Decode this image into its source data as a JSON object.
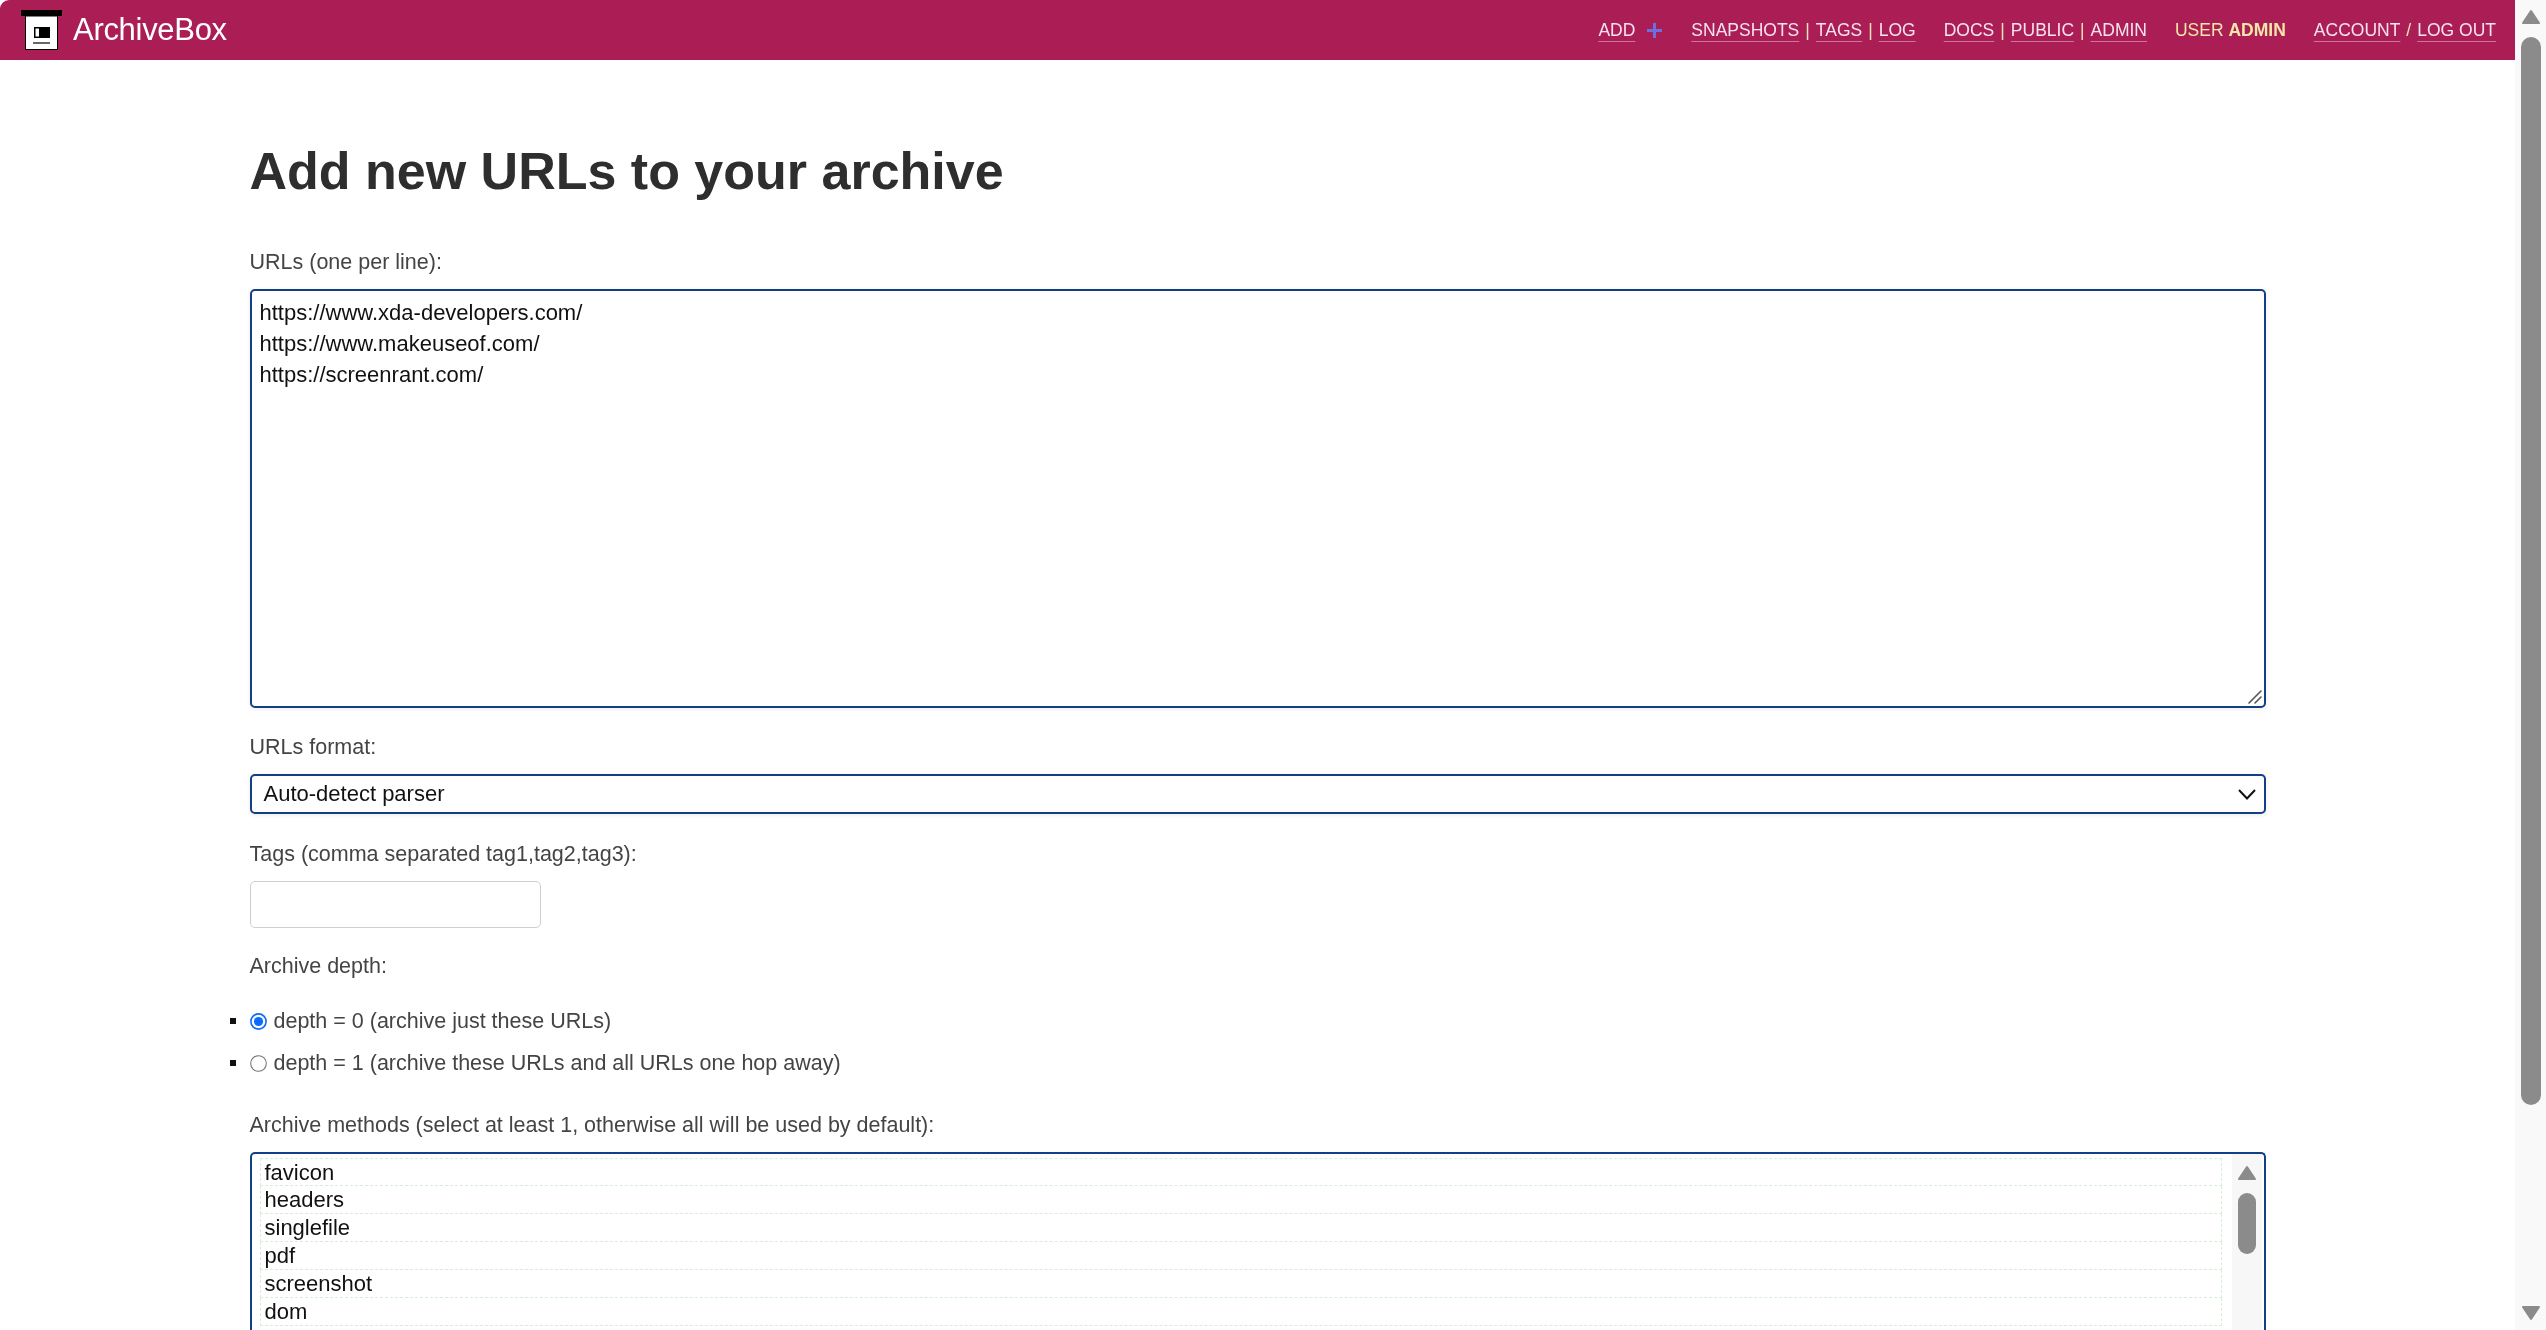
{
  "header": {
    "title": "ArchiveBox",
    "nav": [
      {
        "items": [
          {
            "kind": "add",
            "text": "ADD"
          }
        ]
      },
      {
        "items": [
          {
            "kind": "link",
            "text": "SNAPSHOTS"
          },
          {
            "kind": "sep",
            "text": "|"
          },
          {
            "kind": "link",
            "text": "TAGS"
          },
          {
            "kind": "sep",
            "text": "|"
          },
          {
            "kind": "link",
            "text": "LOG"
          }
        ]
      },
      {
        "items": [
          {
            "kind": "link",
            "text": "DOCS"
          },
          {
            "kind": "sep",
            "text": "|"
          },
          {
            "kind": "link",
            "text": "PUBLIC"
          },
          {
            "kind": "sep",
            "text": "|"
          },
          {
            "kind": "link",
            "text": "ADMIN"
          }
        ]
      },
      {
        "items": [
          {
            "kind": "user",
            "text": "USER **ADMIN**"
          }
        ]
      },
      {
        "items": [
          {
            "kind": "link",
            "text": "ACCOUNT"
          },
          {
            "kind": "sep",
            "text": "/"
          },
          {
            "kind": "link",
            "text": "LOG OUT"
          }
        ]
      }
    ]
  },
  "page": {
    "title": "Add new URLs to your archive"
  },
  "form": {
    "urls": {
      "label": "URLs (one per line):",
      "value": "https://www.xda-developers.com/\nhttps://www.makeuseof.com/\nhttps://screenrant.com/"
    },
    "format": {
      "label": "URLs format:",
      "value": "Auto-detect parser"
    },
    "tags": {
      "label": "Tags (comma separated tag1,tag2,tag3):"
    },
    "depth": {
      "label": "Archive depth:",
      "options": [
        {
          "label": "depth = 0 (archive just these URLs)",
          "selected": true
        },
        {
          "label": "depth = 1 (archive these URLs and all URLs one hop away)",
          "selected": false
        }
      ]
    },
    "methods": {
      "label": "Archive methods (select at least 1, otherwise all will be used by default):",
      "options": [
        {
          "label": "favicon",
          "selected": false
        },
        {
          "label": "headers",
          "selected": false
        },
        {
          "label": "singlefile",
          "selected": false
        },
        {
          "label": "pdf",
          "selected": false
        },
        {
          "label": "screenshot",
          "selected": false
        },
        {
          "label": "dom",
          "selected": false
        }
      ]
    }
  }
}
